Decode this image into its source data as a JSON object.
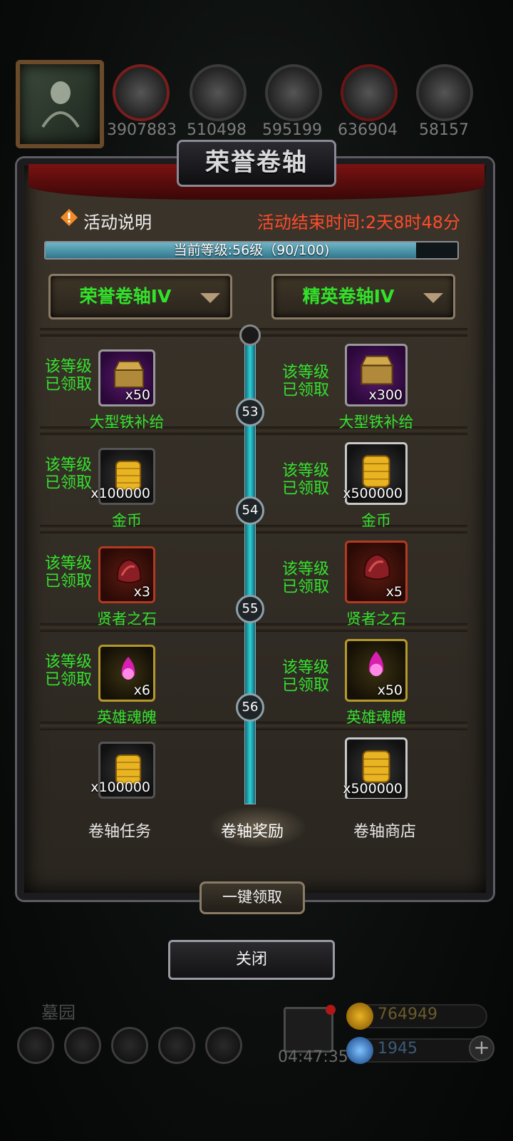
{
  "top": {
    "resources": [
      {
        "icon": "meat-icon",
        "value": "3907883"
      },
      {
        "icon": "wood-icon",
        "value": "510498"
      },
      {
        "icon": "stone-icon",
        "value": "595199"
      },
      {
        "icon": "crystal-icon",
        "value": "636904"
      },
      {
        "icon": "iron-icon",
        "value": "58157"
      }
    ]
  },
  "panel": {
    "title": "荣誉卷轴",
    "info_label": "活动说明",
    "end_time": "活动结束时间:2天8时48分",
    "progress_label": "当前等级:56级（90/100)",
    "progress_fraction": 0.9,
    "dropdown_left": "荣誉卷轴IV",
    "dropdown_right": "精英卷轴IV",
    "claimed_line1": "该等级",
    "claimed_line2": "已领取",
    "rows": [
      {
        "level": "53",
        "left": {
          "icon": "iron-supply-chest-icon",
          "qty": "x50",
          "name": "大型铁补给"
        },
        "right": {
          "icon": "iron-supply-chest-icon",
          "qty": "x300",
          "name": "大型铁补给"
        }
      },
      {
        "level": "54",
        "left": {
          "icon": "gold-coins-icon",
          "qty": "x100000",
          "name": "金币"
        },
        "right": {
          "icon": "gold-coins-icon",
          "qty": "x500000",
          "name": "金币"
        }
      },
      {
        "level": "55",
        "left": {
          "icon": "sage-stone-icon",
          "qty": "x3",
          "name": "贤者之石"
        },
        "right": {
          "icon": "sage-stone-icon",
          "qty": "x5",
          "name": "贤者之石"
        }
      },
      {
        "level": "56",
        "left": {
          "icon": "hero-soul-icon",
          "qty": "x6",
          "name": "英雄魂魄"
        },
        "right": {
          "icon": "hero-soul-icon",
          "qty": "x50",
          "name": "英雄魂魄"
        }
      },
      {
        "level": "",
        "left": {
          "icon": "gold-coins-icon",
          "qty": "x100000",
          "name": ""
        },
        "right": {
          "icon": "gold-coins-icon",
          "qty": "x500000",
          "name": ""
        }
      }
    ],
    "tabs": [
      "卷轴任务",
      "卷轴奖励",
      "卷轴商店"
    ],
    "claim_all": "一键领取"
  },
  "close_label": "关闭",
  "hud": {
    "zone": "墓园",
    "timer": "04:47:35",
    "gold": "764949",
    "gems": "1945"
  },
  "colors": {
    "claimed_green": "#35e22e",
    "end_time_red": "#ff4b2b",
    "progress_teal": "#31788d"
  }
}
